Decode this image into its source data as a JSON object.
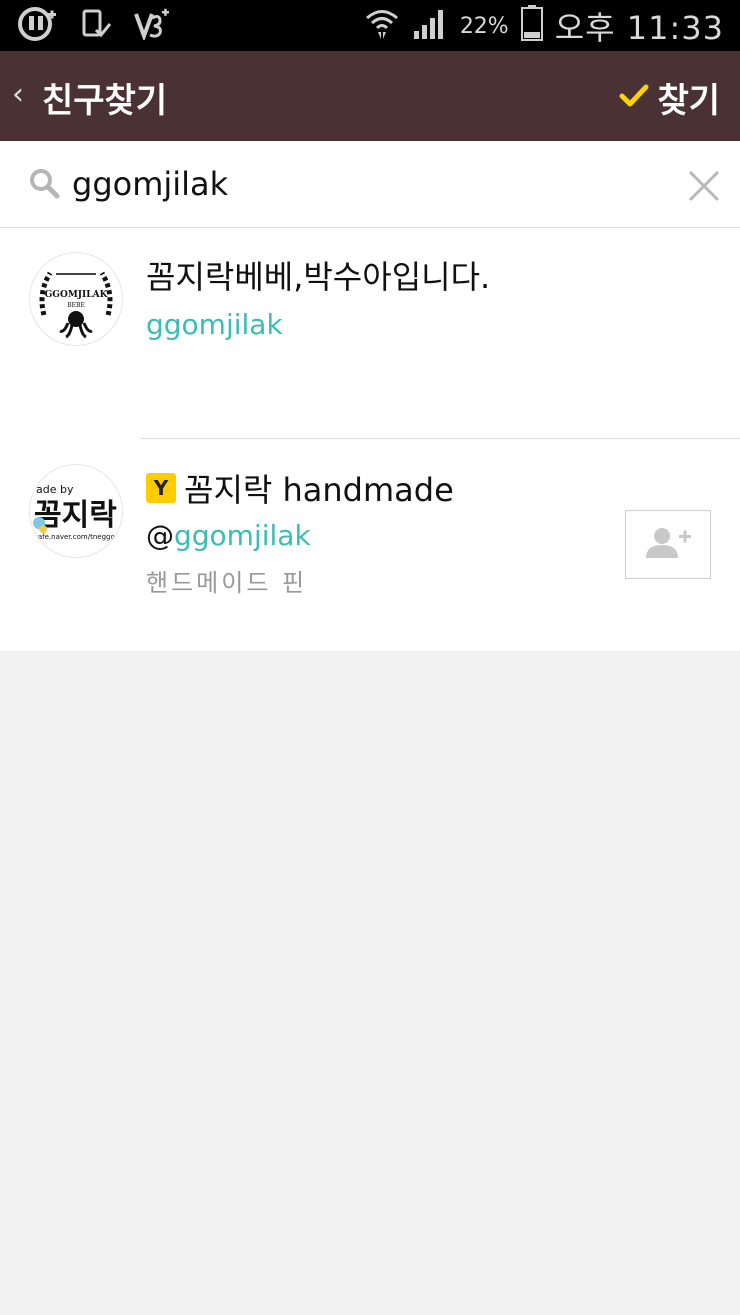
{
  "status_bar": {
    "battery": "22%",
    "time": "오후 11:33"
  },
  "header": {
    "back_icon": "‹",
    "title": "친구찾기",
    "confirm_label": "찾기"
  },
  "search": {
    "value": "ggomjilak",
    "placeholder": ""
  },
  "results": [
    {
      "avatar_text": "GGOMJILAK",
      "avatar_subtext": "BEBE",
      "name": "꼼지락베베,박수아입니다.",
      "id": "ggomjilak"
    },
    {
      "avatar_text": "꼼지락",
      "avatar_top_text": "ade by",
      "avatar_bottom_text": "cafe.naver.com/tneggo",
      "badge": "Y",
      "name": "꼼지락 handmade",
      "id_prefix": "@",
      "id": "ggomjilak",
      "description": "핸드메이드 핀"
    }
  ],
  "colors": {
    "header_bg": "#4a3234",
    "accent_id": "#3bbdb4",
    "check": "#ffd200"
  }
}
